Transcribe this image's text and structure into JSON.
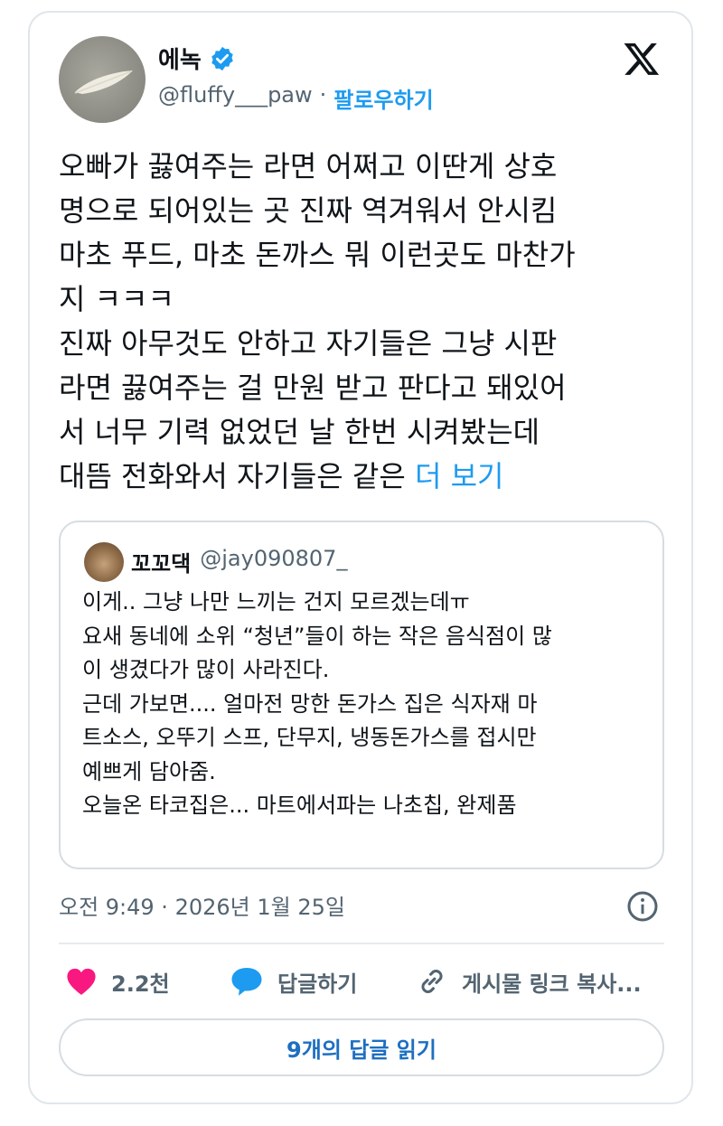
{
  "author": {
    "name": "에녹",
    "handle": "@fluffy___paw",
    "separator": "·",
    "follow_label": "팔로우하기"
  },
  "tweet": {
    "lines": [
      "오빠가 끓여주는 라면 어쩌고 이딴게 상호",
      "명으로 되어있는 곳 진짜 역겨워서 안시킴",
      "마초 푸드, 마초 돈까스 뭐 이런곳도 마찬가",
      "지 ㅋㅋㅋ",
      "진짜 아무것도 안하고 자기들은 그냥 시판",
      "라면 끓여주는 걸 만원 받고 판다고 돼있어",
      "서 너무 기력 없었던 날 한번 시켜봤는데"
    ],
    "last_line": "대뜸 전화와서 자기들은 같은 ",
    "more_label": "더 보기"
  },
  "quote": {
    "name": "꼬꼬댁",
    "handle": "@jay090807_",
    "lines": [
      "이게.. 그냥 나만 느끼는 건지 모르겠는데ㅠ",
      "요새 동네에 소위 “청년”들이 하는 작은 음식점이 많",
      "이 생겼다가 많이 사라진다.",
      "근데 가보면.... 얼마전 망한 돈가스 집은 식자재 마",
      "트소스, 오뚜기 스프, 단무지, 냉동돈가스를 접시만",
      "예쁘게 담아줌.",
      "오늘온 타코집은... 마트에서파는 나초칩, 완제품"
    ]
  },
  "timestamp": "오전 9:49 · 2026년 1월 25일",
  "actions": {
    "like_count": "2.2천",
    "reply_label": "답글하기",
    "copy_link_label": "게시물 링크 복사..."
  },
  "read_replies_label": "9개의 답글 읽기",
  "colors": {
    "accent": "#1d9bf0",
    "like": "#f91880",
    "text": "#0f1419",
    "muted": "#536471"
  }
}
